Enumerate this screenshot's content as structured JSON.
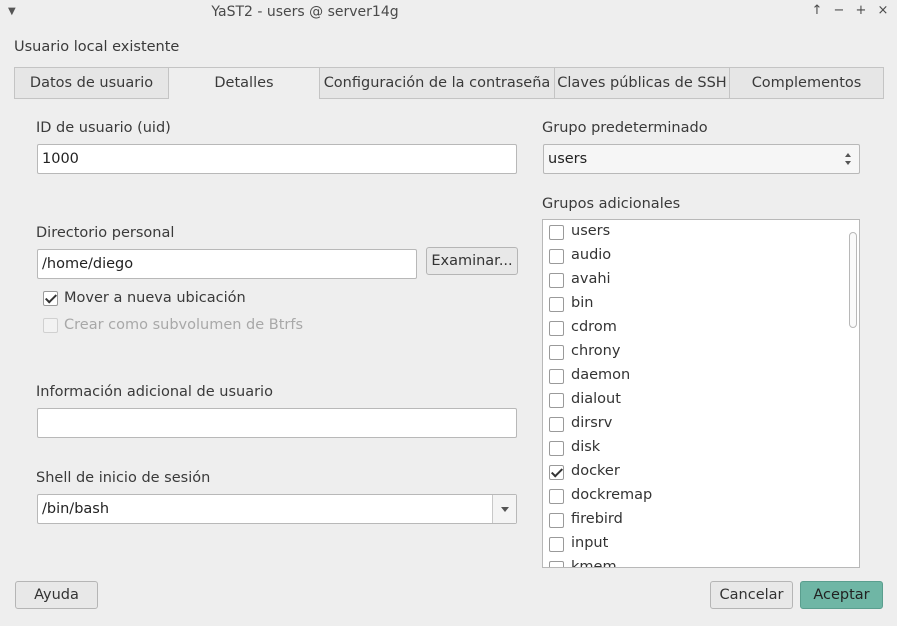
{
  "window": {
    "title": "YaST2 - users @ server14g",
    "controls": [
      "↑",
      "−",
      "+",
      "×"
    ]
  },
  "heading": "Usuario local existente",
  "tabs": [
    {
      "label": "Datos de usuario",
      "active": false
    },
    {
      "label": "Detalles",
      "active": true
    },
    {
      "label": "Configuración de la contraseña",
      "active": false
    },
    {
      "label": "Claves públicas de SSH",
      "active": false
    },
    {
      "label": "Complementos",
      "active": false
    }
  ],
  "uid": {
    "label": "ID de usuario (uid)",
    "value": "1000"
  },
  "home": {
    "label": "Directorio personal",
    "value": "/home/diego",
    "browse_label": "Examinar..."
  },
  "move_home": {
    "label": "Mover a nueva ubicación",
    "checked": true
  },
  "btrfs": {
    "label": "Crear como subvolumen de Btrfs",
    "checked": false,
    "disabled": true
  },
  "gecos": {
    "label": "Información adicional de usuario",
    "value": ""
  },
  "shell": {
    "label": "Shell de inicio de sesión",
    "value": "/bin/bash"
  },
  "default_group": {
    "label": "Grupo predeterminado",
    "value": "users"
  },
  "extra_groups": {
    "label": "Grupos adicionales",
    "items": [
      {
        "name": "users",
        "checked": false
      },
      {
        "name": "audio",
        "checked": false
      },
      {
        "name": "avahi",
        "checked": false
      },
      {
        "name": "bin",
        "checked": false
      },
      {
        "name": "cdrom",
        "checked": false
      },
      {
        "name": "chrony",
        "checked": false
      },
      {
        "name": "daemon",
        "checked": false
      },
      {
        "name": "dialout",
        "checked": false
      },
      {
        "name": "dirsrv",
        "checked": false
      },
      {
        "name": "disk",
        "checked": false
      },
      {
        "name": "docker",
        "checked": true
      },
      {
        "name": "dockremap",
        "checked": false
      },
      {
        "name": "firebird",
        "checked": false
      },
      {
        "name": "input",
        "checked": false
      },
      {
        "name": "kmem",
        "checked": false
      }
    ]
  },
  "buttons": {
    "help": "Ayuda",
    "cancel": "Cancelar",
    "accept": "Aceptar"
  }
}
